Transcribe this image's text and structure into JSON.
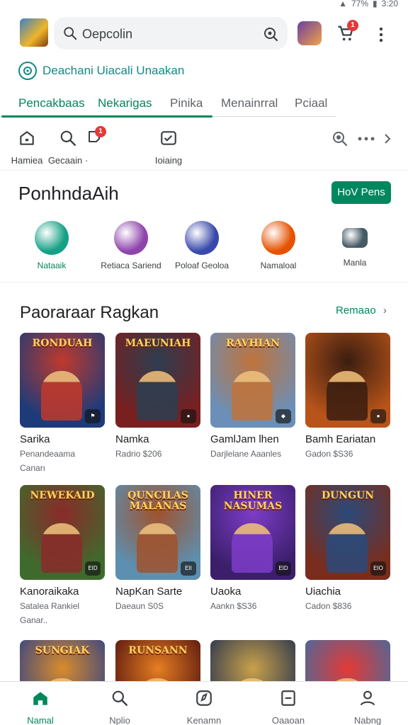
{
  "status": {
    "battery": "77%",
    "time": "3:20"
  },
  "header": {
    "search_placeholder": "Oepcolin",
    "cart_badge": "1"
  },
  "promo": {
    "text": "Deachani Uiacali Unaakan"
  },
  "tabs": [
    {
      "label": "Pencakbaas"
    },
    {
      "label": "Nekarigas"
    },
    {
      "label": "Pinika"
    },
    {
      "label": "Menainrral"
    },
    {
      "label": "Pciaal"
    }
  ],
  "quick": {
    "items": [
      {
        "label": "Hamiea",
        "icon": "home-outline-icon"
      },
      {
        "label": "Gecaain ·",
        "icon": "search-icon",
        "badge": ""
      },
      {
        "label": "Ioiaing",
        "icon": "inbox-check-icon"
      }
    ],
    "notif_badge": "1"
  },
  "section1": {
    "title": "PonhndaAih",
    "button": "HoV Pens",
    "categories": [
      {
        "label": "Nataaik",
        "color": "#16a085"
      },
      {
        "label": "Retiaca Sariend",
        "color": "#8e44ad"
      },
      {
        "label": "Poloaf Geoloa",
        "color": "#3949ab"
      },
      {
        "label": "Namaloal",
        "color": "#e65100"
      },
      {
        "label": "Manla",
        "color": "#455a64"
      }
    ]
  },
  "section2": {
    "title": "Paoraraar Ragkan",
    "more": "Remaao",
    "games": [
      {
        "art_title": "RONDUAH",
        "name": "Sarika",
        "sub1": "Penandeaama",
        "sub2": "Canarı",
        "bg": "#1d3b7a",
        "accent": "#c0392b",
        "chip": "⚑"
      },
      {
        "art_title": "MAEUNIAH",
        "name": "Namka",
        "sub1": "Radrio $206",
        "sub2": "",
        "bg": "#7a1f1f",
        "accent": "#2c3e50",
        "chip": "●"
      },
      {
        "art_title": "RAVHIAN",
        "name": "GamlJam lhen",
        "sub1": "Darjlelane Aaanles",
        "sub2": "",
        "bg": "#6b8fb8",
        "accent": "#c0733a",
        "chip": "◆"
      },
      {
        "art_title": "",
        "name": "Bamh Eariatan",
        "sub1": "Gadon $S36",
        "sub2": "",
        "bg": "#b8541a",
        "accent": "#3a1d10",
        "chip": "●"
      },
      {
        "art_title": "NEWEKAID",
        "name": "Kanoraikaka",
        "sub1": "Satalea Rankiel",
        "sub2": "Ganar..",
        "bg": "#3e6b2c",
        "accent": "#8a2a2a",
        "chip": "EID"
      },
      {
        "art_title": "QUNCILAS MALANAS",
        "name": "NapKan Sarte",
        "sub1": "Daeaun S0S",
        "sub2": "",
        "bg": "#5d8fb0",
        "accent": "#a0522d",
        "chip": "EII"
      },
      {
        "art_title": "HINER NASUMAS",
        "name": "Uaoka",
        "sub1": "Aankn $S36",
        "sub2": "",
        "bg": "#3b1f6b",
        "accent": "#7d3cc8",
        "chip": "EID"
      },
      {
        "art_title": "DUNGUN",
        "name": "Uiachia",
        "sub1": "Cadon $836",
        "sub2": "",
        "bg": "#7a2d1c",
        "accent": "#2a4a7a",
        "chip": "EIO"
      },
      {
        "art_title": "SUNGIAK",
        "name": "",
        "sub1": "",
        "sub2": "",
        "bg": "#2b3f8a",
        "accent": "#d98c2b",
        "chip": ""
      },
      {
        "art_title": "RUNSANN",
        "name": "",
        "sub1": "",
        "sub2": "",
        "bg": "#4a0d0d",
        "accent": "#e67e22",
        "chip": ""
      },
      {
        "art_title": "",
        "name": "",
        "sub1": "",
        "sub2": "",
        "bg": "#1f2d4f",
        "accent": "#c9a24a",
        "chip": ""
      },
      {
        "art_title": "",
        "name": "",
        "sub1": "",
        "sub2": "",
        "bg": "#3a6ea5",
        "accent": "#e53935",
        "chip": ""
      }
    ]
  },
  "bottom_nav": [
    {
      "label": "Namal",
      "icon": "home-icon"
    },
    {
      "label": "Nplio",
      "icon": "search-icon"
    },
    {
      "label": "Kenamn",
      "icon": "compass-icon"
    },
    {
      "label": "Oaaoan",
      "icon": "book-icon"
    },
    {
      "label": "Nabng",
      "icon": "person-icon"
    }
  ]
}
